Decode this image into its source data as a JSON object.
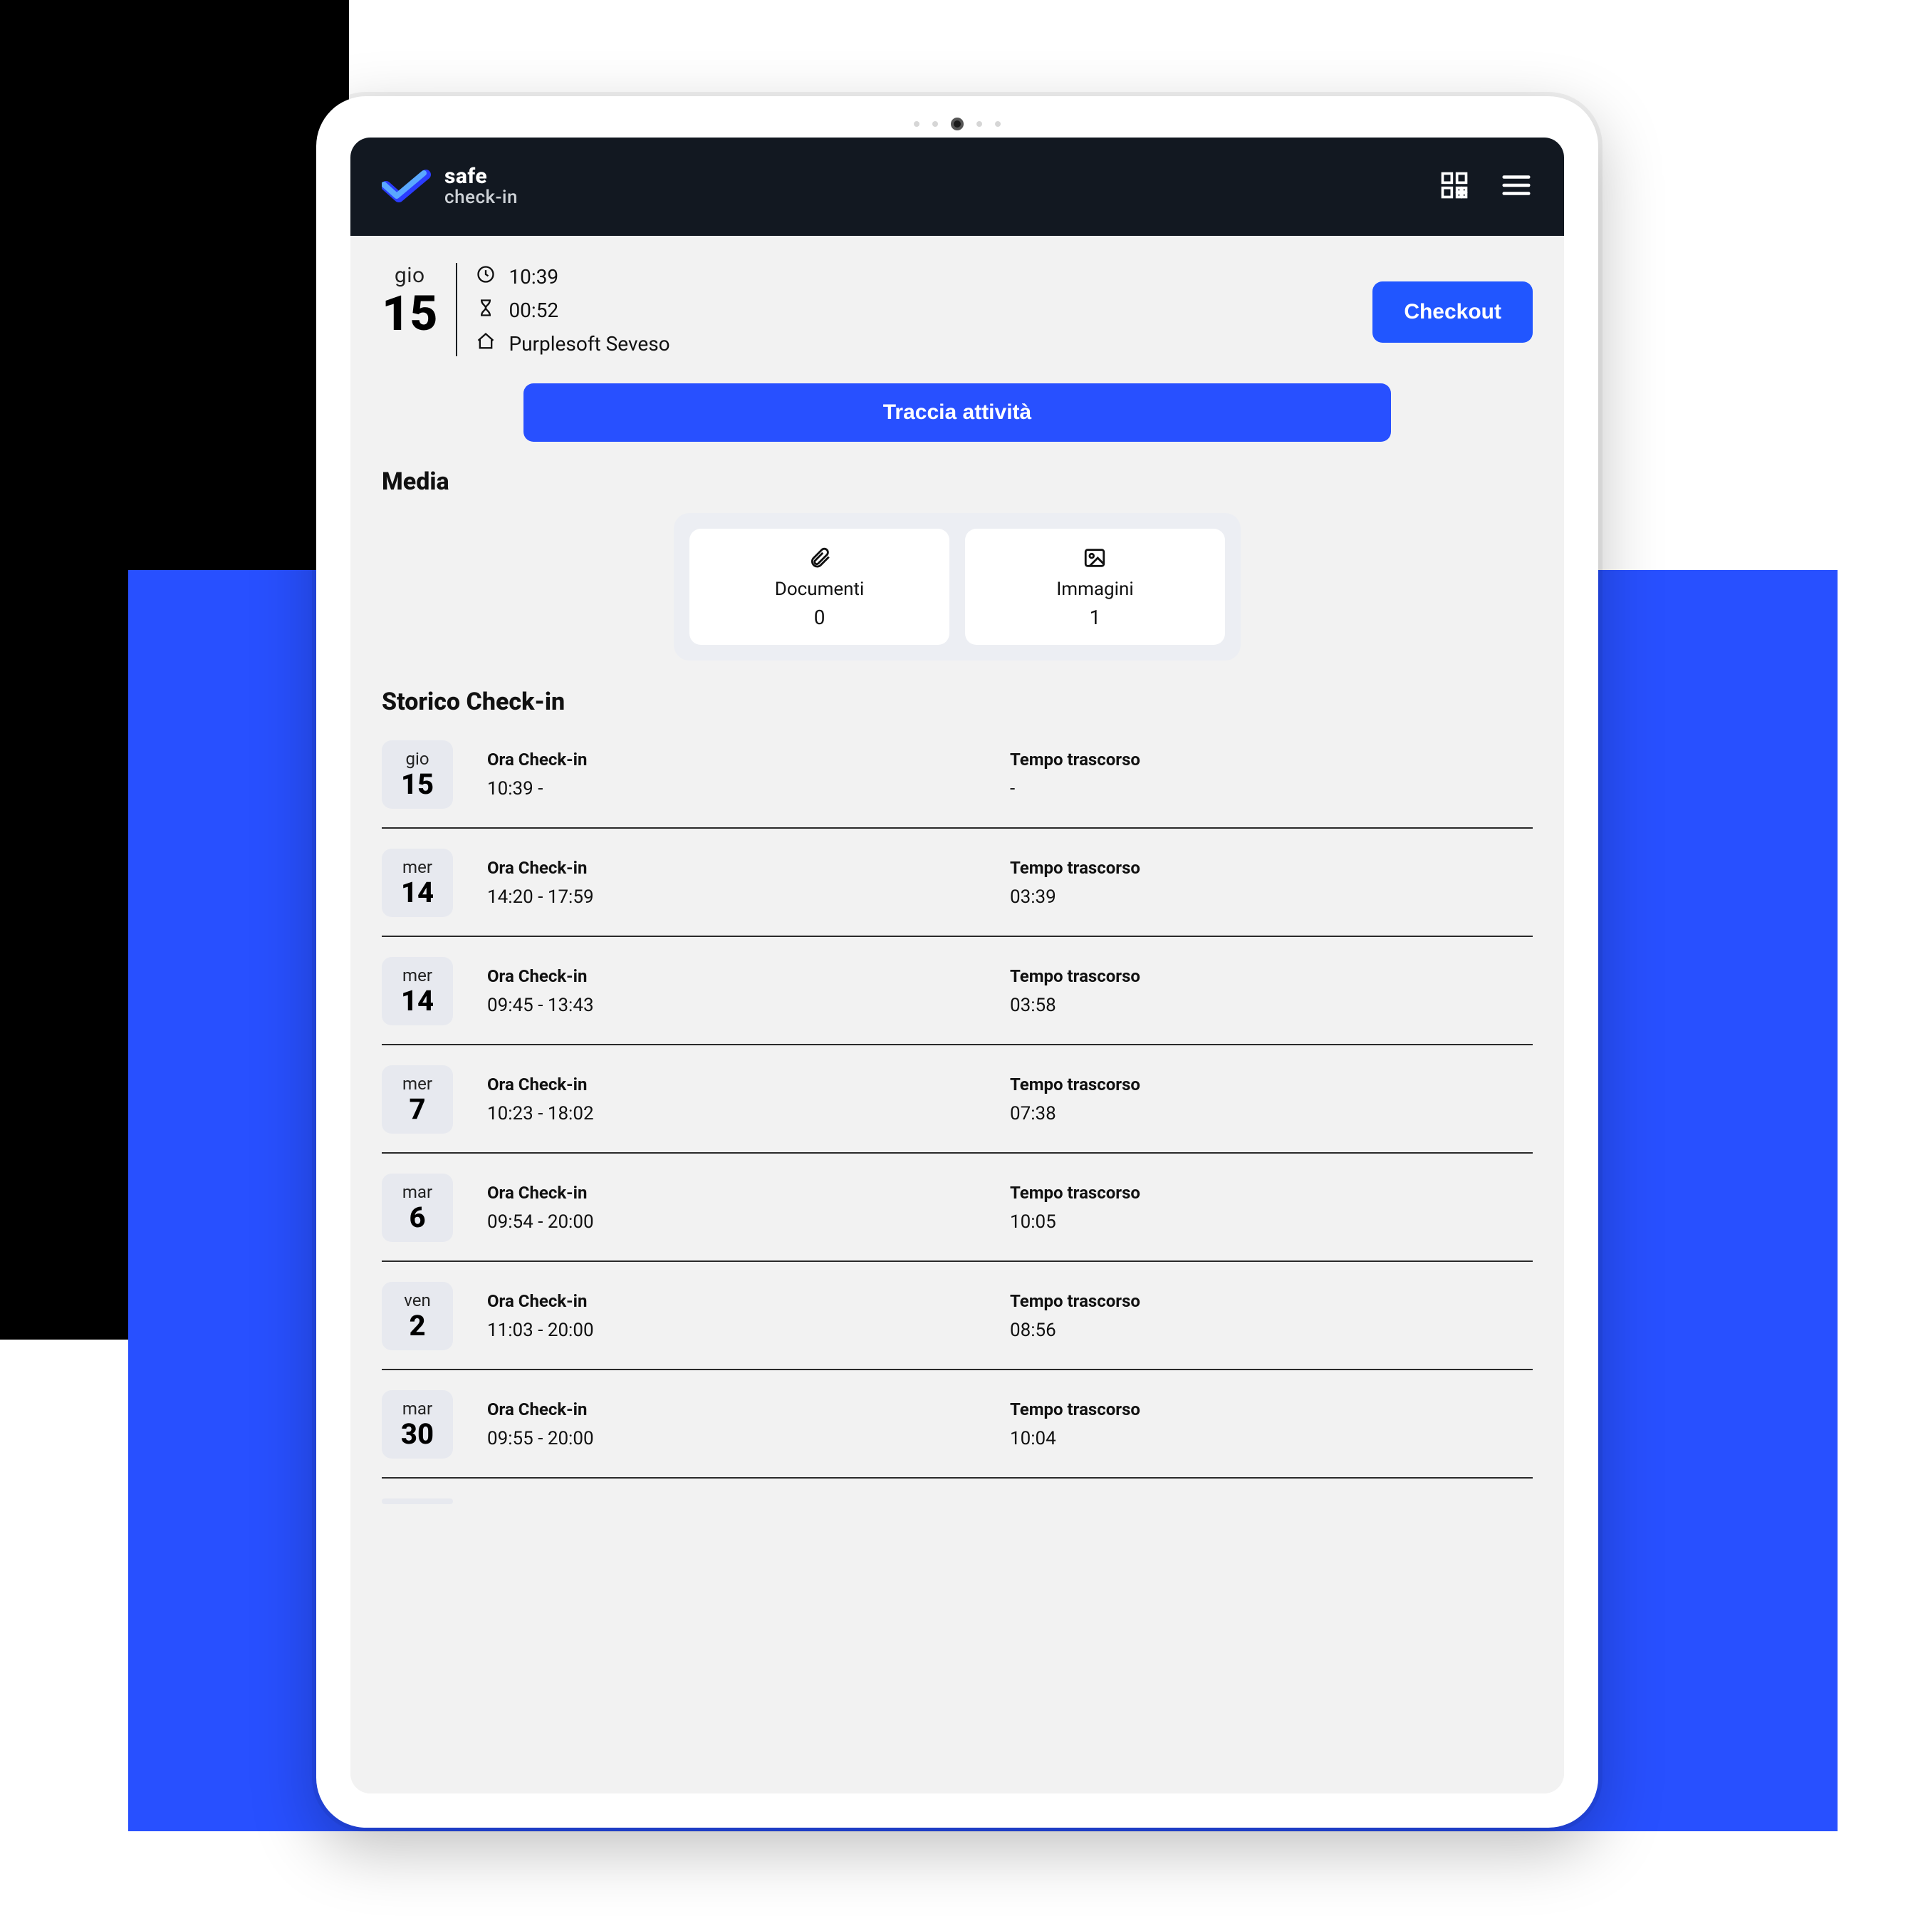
{
  "brand": {
    "line1": "safe",
    "line2": "check-in"
  },
  "session": {
    "dow": "gio",
    "dnum": "15",
    "time": "10:39",
    "elapsed": "00:52",
    "location": "Purplesoft Seveso",
    "checkout_label": "Checkout",
    "track_label": "Traccia attività"
  },
  "labels": {
    "media_title": "Media",
    "documents": "Documenti",
    "images": "Immagini",
    "history_title": "Storico Check-in",
    "checkin_time": "Ora Check-in",
    "elapsed": "Tempo trascorso"
  },
  "media": {
    "documents_count": "0",
    "images_count": "1"
  },
  "history": [
    {
      "dow": "gio",
      "dnum": "15",
      "range": "10:39 -",
      "elapsed": "-"
    },
    {
      "dow": "mer",
      "dnum": "14",
      "range": "14:20 - 17:59",
      "elapsed": "03:39"
    },
    {
      "dow": "mer",
      "dnum": "14",
      "range": "09:45 - 13:43",
      "elapsed": "03:58"
    },
    {
      "dow": "mer",
      "dnum": "7",
      "range": "10:23 - 18:02",
      "elapsed": "07:38"
    },
    {
      "dow": "mar",
      "dnum": "6",
      "range": "09:54 - 20:00",
      "elapsed": "10:05"
    },
    {
      "dow": "ven",
      "dnum": "2",
      "range": "11:03 - 20:00",
      "elapsed": "08:56"
    },
    {
      "dow": "mar",
      "dnum": "30",
      "range": "09:55 - 20:00",
      "elapsed": "10:04"
    }
  ]
}
